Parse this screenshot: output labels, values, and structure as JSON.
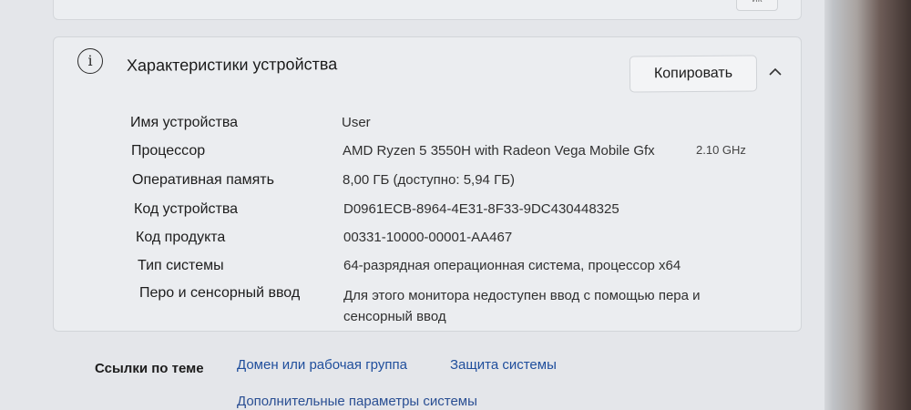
{
  "top_fragment": {
    "button_hint": "ик"
  },
  "specs": {
    "title": "Характеристики устройства",
    "copy_label": "Копировать",
    "rows": [
      {
        "label": "Имя устройства",
        "value": "User"
      },
      {
        "label": "Процессор",
        "value": "AMD Ryzen 5 3550H with Radeon Vega Mobile Gfx",
        "extra": "2.10 GHz"
      },
      {
        "label": "Оперативная память",
        "value": "8,00 ГБ (доступно: 5,94 ГБ)"
      },
      {
        "label": "Код устройства",
        "value": "D0961ECB-8964-4E31-8F33-9DC430448325"
      },
      {
        "label": "Код продукта",
        "value": "00331-10000-00001-AA467"
      },
      {
        "label": "Тип системы",
        "value": "64-разрядная операционная система, процессор x64"
      },
      {
        "label": "Перо и сенсорный ввод",
        "value": "Для этого монитора недоступен ввод с помощью пера и сенсорный ввод"
      }
    ]
  },
  "related_links": {
    "title": "Ссылки по теме",
    "links": [
      "Домен или рабочая группа",
      "Защита системы"
    ],
    "more": "Дополнительные параметры системы"
  },
  "icons": {
    "info": "info-icon",
    "collapse": "chevron-up-icon"
  }
}
